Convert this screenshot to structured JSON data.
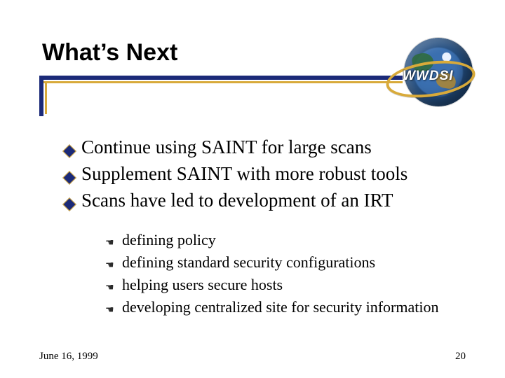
{
  "title": "What’s Next",
  "logo_text": "WWDSI",
  "bullets": [
    "Continue using SAINT for large scans",
    "Supplement SAINT with more robust tools",
    "Scans have led to development of an IRT"
  ],
  "sub_bullets": [
    "defining policy",
    "defining standard security configurations",
    "helping users secure hosts",
    "developing centralized site for security information"
  ],
  "footer": {
    "date": "June 16, 1999",
    "page": "20"
  }
}
